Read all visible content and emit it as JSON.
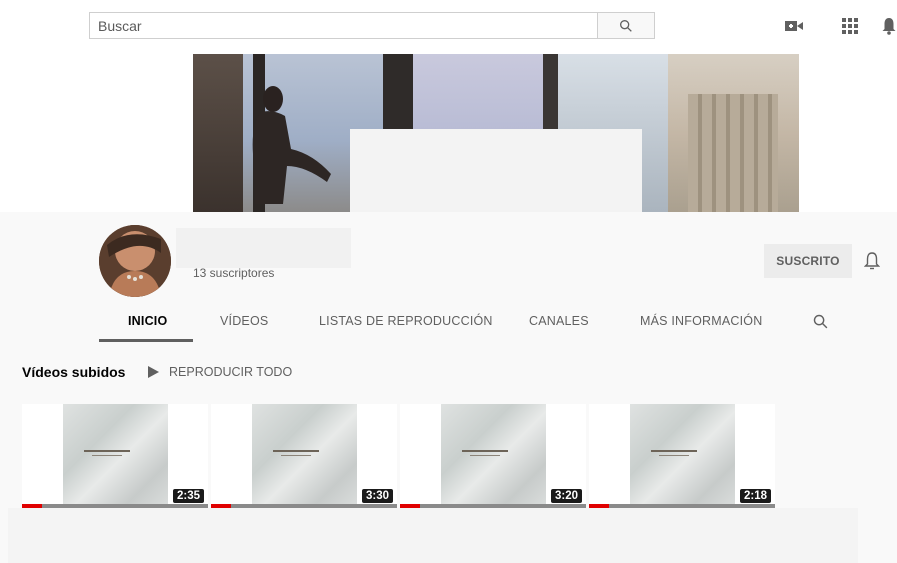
{
  "search": {
    "placeholder": "Buscar",
    "value": ""
  },
  "topbar": {
    "icons": [
      "video-camera-icon",
      "apps-grid-icon",
      "bell-icon"
    ]
  },
  "channel": {
    "subscribers": "13 suscriptores",
    "subscribe_label": "SUSCRITO"
  },
  "tabs": [
    {
      "label": "INICIO",
      "active": true
    },
    {
      "label": "VÍDEOS",
      "active": false
    },
    {
      "label": "LISTAS DE REPRODUCCIÓN",
      "active": false
    },
    {
      "label": "CANALES",
      "active": false
    },
    {
      "label": "MÁS INFORMACIÓN",
      "active": false
    }
  ],
  "uploads": {
    "title": "Vídeos subidos",
    "play_all": "REPRODUCIR TODO",
    "videos": [
      {
        "duration": "2:35",
        "watched_fraction": 0.11
      },
      {
        "duration": "3:30",
        "watched_fraction": 0.11
      },
      {
        "duration": "3:20",
        "watched_fraction": 0.11
      },
      {
        "duration": "2:18",
        "watched_fraction": 0.11
      }
    ]
  },
  "colors": {
    "accent": "#e00000",
    "text_secondary": "#606060",
    "background": "#f9f9f9"
  }
}
